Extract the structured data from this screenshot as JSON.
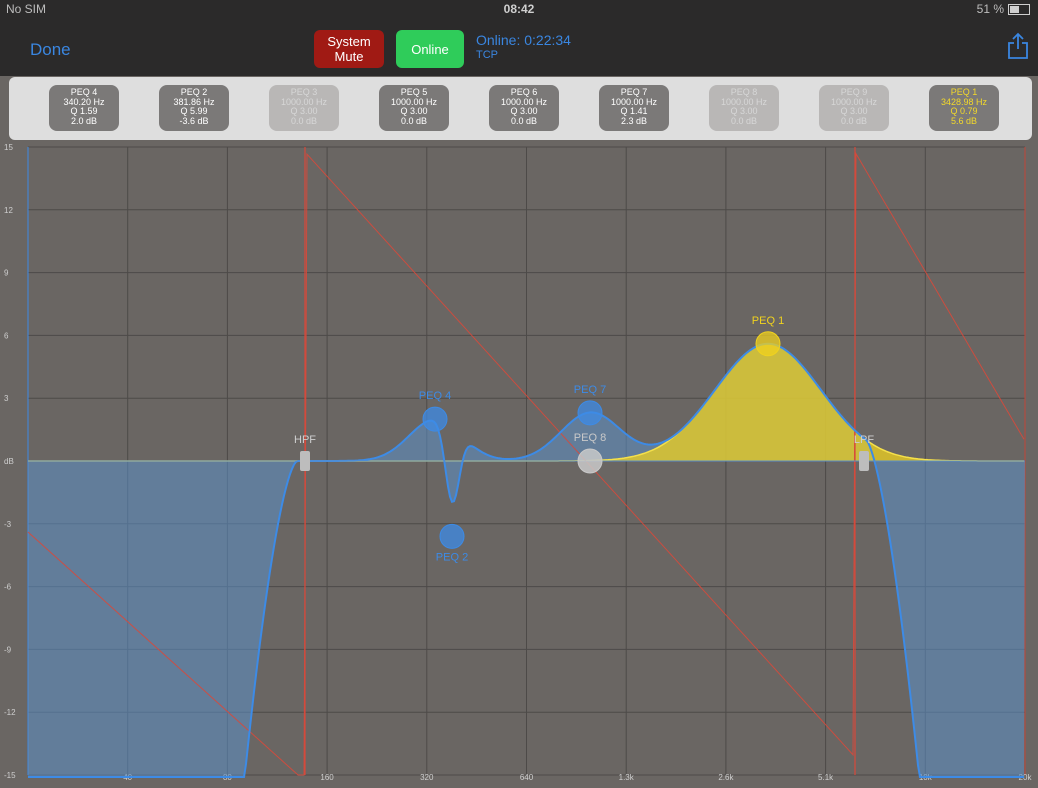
{
  "status_bar": {
    "carrier": "No SIM",
    "time": "08:42",
    "battery": "51 %",
    "battery_level": 0.51
  },
  "nav": {
    "done_label": "Done",
    "mute_label": "System\nMute",
    "online_button_label": "Online",
    "online_status": "Online: 0:22:34",
    "protocol": "TCP"
  },
  "bands": [
    {
      "name": "PEQ 4",
      "freq": "340.20 Hz",
      "q": "Q 1.59",
      "gain": "2.0 dB",
      "state": "active"
    },
    {
      "name": "PEQ 2",
      "freq": "381.86 Hz",
      "q": "Q 5.99",
      "gain": "-3.6 dB",
      "state": "active"
    },
    {
      "name": "PEQ 3",
      "freq": "1000.00 Hz",
      "q": "Q 3.00",
      "gain": "0.0 dB",
      "state": "inactive"
    },
    {
      "name": "PEQ 5",
      "freq": "1000.00 Hz",
      "q": "Q 3.00",
      "gain": "0.0 dB",
      "state": "active"
    },
    {
      "name": "PEQ 6",
      "freq": "1000.00 Hz",
      "q": "Q 3.00",
      "gain": "0.0 dB",
      "state": "active"
    },
    {
      "name": "PEQ 7",
      "freq": "1000.00 Hz",
      "q": "Q 1.41",
      "gain": "2.3 dB",
      "state": "active"
    },
    {
      "name": "PEQ 8",
      "freq": "1000.00 Hz",
      "q": "Q 3.00",
      "gain": "0.0 dB",
      "state": "inactive"
    },
    {
      "name": "PEQ 9",
      "freq": "1000.00 Hz",
      "q": "Q 3.00",
      "gain": "0.0 dB",
      "state": "inactive"
    },
    {
      "name": "PEQ 1",
      "freq": "3428.98 Hz",
      "q": "Q 0.79",
      "gain": "5.6 dB",
      "state": "selected"
    }
  ],
  "graph": {
    "y_ticks": [
      "15",
      "12",
      "9",
      "6",
      "3",
      "dB",
      "-3",
      "-6",
      "-9",
      "-12",
      "-15"
    ],
    "x_ticks": [
      "40",
      "80",
      "160",
      "320",
      "640",
      "1.3k",
      "2.6k",
      "5.1k",
      "10k",
      "20k"
    ],
    "handles": [
      {
        "label": "PEQ 4",
        "type": "peq"
      },
      {
        "label": "PEQ 2",
        "type": "peq"
      },
      {
        "label": "PEQ 7",
        "type": "peq"
      },
      {
        "label": "PEQ 8",
        "type": "peq-off"
      },
      {
        "label": "PEQ 1",
        "type": "peq-selected"
      },
      {
        "label": "HPF",
        "type": "filter"
      },
      {
        "label": "LPF",
        "type": "filter"
      }
    ],
    "colors": {
      "background": "#6a6663",
      "grid": "#4d4a48",
      "response_line": "#3d8be6",
      "response_fill": "#5b8fc8",
      "selected_band": "#f0d21e",
      "phase_line": "#d8493b"
    }
  }
}
